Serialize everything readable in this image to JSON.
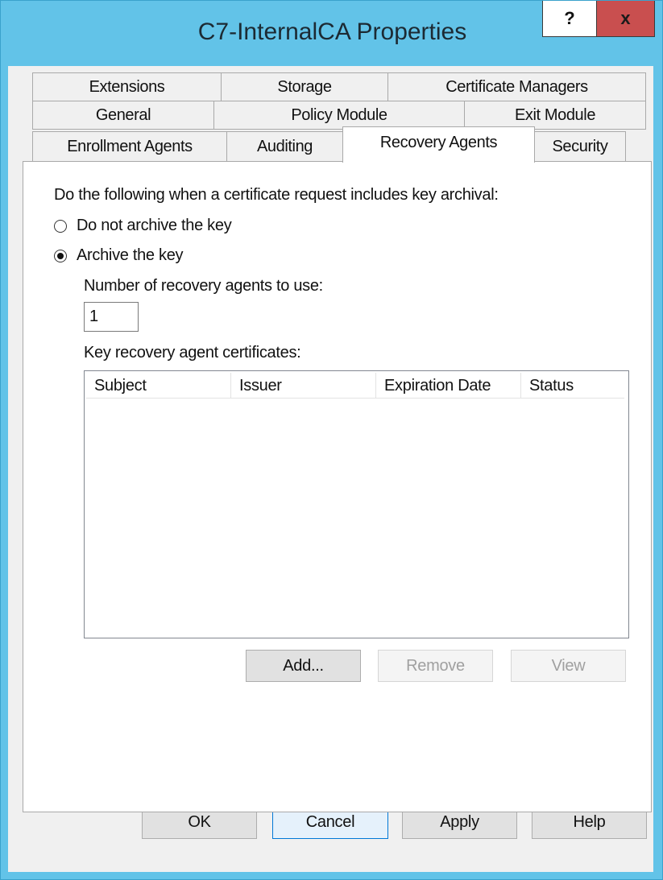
{
  "window": {
    "title": "C7-InternalCA Properties",
    "help_label": "?",
    "close_label": "x"
  },
  "tabs": {
    "row1": [
      "Extensions",
      "Storage",
      "Certificate Managers"
    ],
    "row2": [
      "General",
      "Policy Module",
      "Exit Module"
    ],
    "row3": [
      "Enrollment Agents",
      "Auditing",
      "Recovery Agents",
      "Security"
    ],
    "active": "Recovery Agents"
  },
  "panel": {
    "prompt": "Do the following when a certificate request includes key archival:",
    "option_no_archive": "Do not archive the key",
    "option_archive": "Archive the key",
    "selected_option": "Archive the key",
    "agents_count_label": "Number of recovery agents to use:",
    "agents_count_value": "1",
    "certs_label": "Key recovery agent certificates:",
    "columns": [
      "Subject",
      "Issuer",
      "Expiration Date",
      "Status"
    ],
    "rows": [],
    "add_label": "Add...",
    "remove_label": "Remove",
    "view_label": "View"
  },
  "footer": {
    "ok_label": "OK",
    "cancel_label": "Cancel",
    "apply_label": "Apply",
    "help_label": "Help"
  },
  "colors": {
    "titlebar": "#62c3e8",
    "close_button": "#c94f4f",
    "dialog_background": "#f0f0f0",
    "focus_border": "#0078d7"
  }
}
